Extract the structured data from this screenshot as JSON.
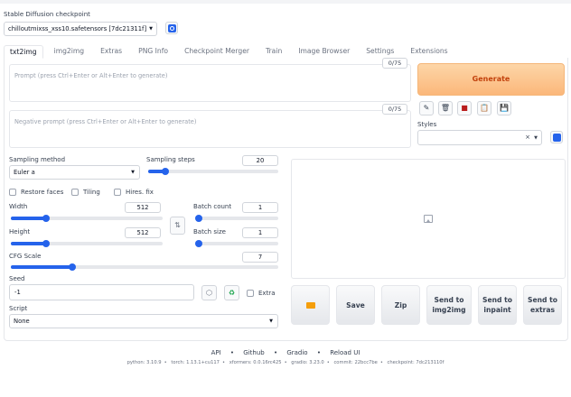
{
  "checkpoint": {
    "label": "Stable Diffusion checkpoint",
    "value": "chilloutmixss_xss10.safetensors [7dc21311f]"
  },
  "tabs": [
    {
      "label": "txt2img",
      "active": true
    },
    {
      "label": "img2img"
    },
    {
      "label": "Extras"
    },
    {
      "label": "PNG Info"
    },
    {
      "label": "Checkpoint Merger"
    },
    {
      "label": "Train"
    },
    {
      "label": "Image Browser"
    },
    {
      "label": "Settings"
    },
    {
      "label": "Extensions"
    }
  ],
  "prompt": {
    "placeholder": "Prompt (press Ctrl+Enter or Alt+Enter to generate)",
    "counter": "0/75"
  },
  "negative_prompt": {
    "placeholder": "Negative prompt (press Ctrl+Enter or Alt+Enter to generate)",
    "counter": "0/75"
  },
  "generate_label": "Generate",
  "tools": {
    "icons": [
      "pencil-icon",
      "trash-icon",
      "red-book-icon",
      "clipboard-icon",
      "save-icon"
    ],
    "glyphs": [
      "✎",
      "🗑",
      "■",
      "📋",
      "💾"
    ]
  },
  "styles": {
    "label": "Styles",
    "clear": "×",
    "arrow": "▼"
  },
  "sampling_method": {
    "label": "Sampling method",
    "value": "Euler a"
  },
  "sampling_steps": {
    "label": "Sampling steps",
    "value": "20",
    "fraction": 0.13
  },
  "checkboxes": {
    "restore_faces": "Restore faces",
    "tiling": "Tiling",
    "hires_fix": "Hires. fix"
  },
  "width": {
    "label": "Width",
    "value": "512",
    "fraction": 0.23
  },
  "height": {
    "label": "Height",
    "value": "512",
    "fraction": 0.23
  },
  "batch_count": {
    "label": "Batch count",
    "value": "1",
    "fraction": 0.0
  },
  "batch_size": {
    "label": "Batch size",
    "value": "1",
    "fraction": 0.0
  },
  "cfg_scale": {
    "label": "CFG Scale",
    "value": "7",
    "fraction": 0.23
  },
  "seed": {
    "label": "Seed",
    "value": "-1",
    "extra_label": "Extra"
  },
  "script": {
    "label": "Script",
    "value": "None"
  },
  "swap_glyph": "⇅",
  "seed_glyphs": {
    "dice": "⬡",
    "recycle": "♻"
  },
  "actions": [
    {
      "name": "open-folder-button",
      "label": ""
    },
    {
      "name": "save-button",
      "label": "Save"
    },
    {
      "name": "zip-button",
      "label": "Zip"
    },
    {
      "name": "send-to-img2img-button",
      "label": "Send to img2img"
    },
    {
      "name": "send-to-inpaint-button",
      "label": "Send to inpaint"
    },
    {
      "name": "send-to-extras-button",
      "label": "Send to extras"
    }
  ],
  "footer": {
    "links": [
      "API",
      "Github",
      "Gradio",
      "Reload UI"
    ],
    "separator": "•",
    "info": [
      "python: 3.10.9",
      "torch: 1.13.1+cu117",
      "xformers: 0.0.16rc425",
      "gradio: 3.23.0",
      "commit: 22bcc7be",
      "checkpoint: 7dc213110f"
    ]
  },
  "colors": {
    "accent": "#2563eb",
    "generate_bg": "#fbb77a",
    "generate_text": "#c2410c"
  }
}
